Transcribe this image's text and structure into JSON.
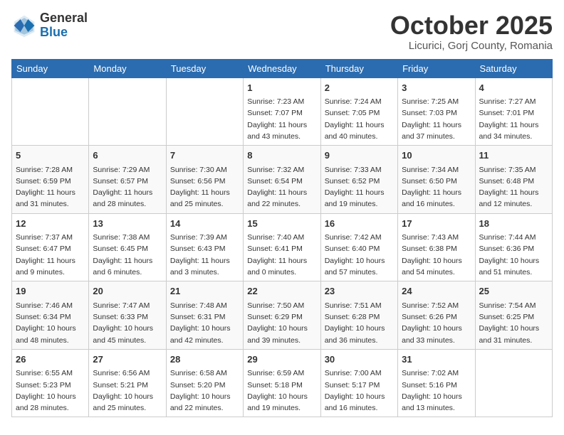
{
  "header": {
    "logo_general": "General",
    "logo_blue": "Blue",
    "month_title": "October 2025",
    "location": "Licurici, Gorj County, Romania"
  },
  "days_of_week": [
    "Sunday",
    "Monday",
    "Tuesday",
    "Wednesday",
    "Thursday",
    "Friday",
    "Saturday"
  ],
  "weeks": [
    [
      {
        "day": "",
        "info": ""
      },
      {
        "day": "",
        "info": ""
      },
      {
        "day": "",
        "info": ""
      },
      {
        "day": "1",
        "info": "Sunrise: 7:23 AM\nSunset: 7:07 PM\nDaylight: 11 hours and 43 minutes."
      },
      {
        "day": "2",
        "info": "Sunrise: 7:24 AM\nSunset: 7:05 PM\nDaylight: 11 hours and 40 minutes."
      },
      {
        "day": "3",
        "info": "Sunrise: 7:25 AM\nSunset: 7:03 PM\nDaylight: 11 hours and 37 minutes."
      },
      {
        "day": "4",
        "info": "Sunrise: 7:27 AM\nSunset: 7:01 PM\nDaylight: 11 hours and 34 minutes."
      }
    ],
    [
      {
        "day": "5",
        "info": "Sunrise: 7:28 AM\nSunset: 6:59 PM\nDaylight: 11 hours and 31 minutes."
      },
      {
        "day": "6",
        "info": "Sunrise: 7:29 AM\nSunset: 6:57 PM\nDaylight: 11 hours and 28 minutes."
      },
      {
        "day": "7",
        "info": "Sunrise: 7:30 AM\nSunset: 6:56 PM\nDaylight: 11 hours and 25 minutes."
      },
      {
        "day": "8",
        "info": "Sunrise: 7:32 AM\nSunset: 6:54 PM\nDaylight: 11 hours and 22 minutes."
      },
      {
        "day": "9",
        "info": "Sunrise: 7:33 AM\nSunset: 6:52 PM\nDaylight: 11 hours and 19 minutes."
      },
      {
        "day": "10",
        "info": "Sunrise: 7:34 AM\nSunset: 6:50 PM\nDaylight: 11 hours and 16 minutes."
      },
      {
        "day": "11",
        "info": "Sunrise: 7:35 AM\nSunset: 6:48 PM\nDaylight: 11 hours and 12 minutes."
      }
    ],
    [
      {
        "day": "12",
        "info": "Sunrise: 7:37 AM\nSunset: 6:47 PM\nDaylight: 11 hours and 9 minutes."
      },
      {
        "day": "13",
        "info": "Sunrise: 7:38 AM\nSunset: 6:45 PM\nDaylight: 11 hours and 6 minutes."
      },
      {
        "day": "14",
        "info": "Sunrise: 7:39 AM\nSunset: 6:43 PM\nDaylight: 11 hours and 3 minutes."
      },
      {
        "day": "15",
        "info": "Sunrise: 7:40 AM\nSunset: 6:41 PM\nDaylight: 11 hours and 0 minutes."
      },
      {
        "day": "16",
        "info": "Sunrise: 7:42 AM\nSunset: 6:40 PM\nDaylight: 10 hours and 57 minutes."
      },
      {
        "day": "17",
        "info": "Sunrise: 7:43 AM\nSunset: 6:38 PM\nDaylight: 10 hours and 54 minutes."
      },
      {
        "day": "18",
        "info": "Sunrise: 7:44 AM\nSunset: 6:36 PM\nDaylight: 10 hours and 51 minutes."
      }
    ],
    [
      {
        "day": "19",
        "info": "Sunrise: 7:46 AM\nSunset: 6:34 PM\nDaylight: 10 hours and 48 minutes."
      },
      {
        "day": "20",
        "info": "Sunrise: 7:47 AM\nSunset: 6:33 PM\nDaylight: 10 hours and 45 minutes."
      },
      {
        "day": "21",
        "info": "Sunrise: 7:48 AM\nSunset: 6:31 PM\nDaylight: 10 hours and 42 minutes."
      },
      {
        "day": "22",
        "info": "Sunrise: 7:50 AM\nSunset: 6:29 PM\nDaylight: 10 hours and 39 minutes."
      },
      {
        "day": "23",
        "info": "Sunrise: 7:51 AM\nSunset: 6:28 PM\nDaylight: 10 hours and 36 minutes."
      },
      {
        "day": "24",
        "info": "Sunrise: 7:52 AM\nSunset: 6:26 PM\nDaylight: 10 hours and 33 minutes."
      },
      {
        "day": "25",
        "info": "Sunrise: 7:54 AM\nSunset: 6:25 PM\nDaylight: 10 hours and 31 minutes."
      }
    ],
    [
      {
        "day": "26",
        "info": "Sunrise: 6:55 AM\nSunset: 5:23 PM\nDaylight: 10 hours and 28 minutes."
      },
      {
        "day": "27",
        "info": "Sunrise: 6:56 AM\nSunset: 5:21 PM\nDaylight: 10 hours and 25 minutes."
      },
      {
        "day": "28",
        "info": "Sunrise: 6:58 AM\nSunset: 5:20 PM\nDaylight: 10 hours and 22 minutes."
      },
      {
        "day": "29",
        "info": "Sunrise: 6:59 AM\nSunset: 5:18 PM\nDaylight: 10 hours and 19 minutes."
      },
      {
        "day": "30",
        "info": "Sunrise: 7:00 AM\nSunset: 5:17 PM\nDaylight: 10 hours and 16 minutes."
      },
      {
        "day": "31",
        "info": "Sunrise: 7:02 AM\nSunset: 5:16 PM\nDaylight: 10 hours and 13 minutes."
      },
      {
        "day": "",
        "info": ""
      }
    ]
  ]
}
